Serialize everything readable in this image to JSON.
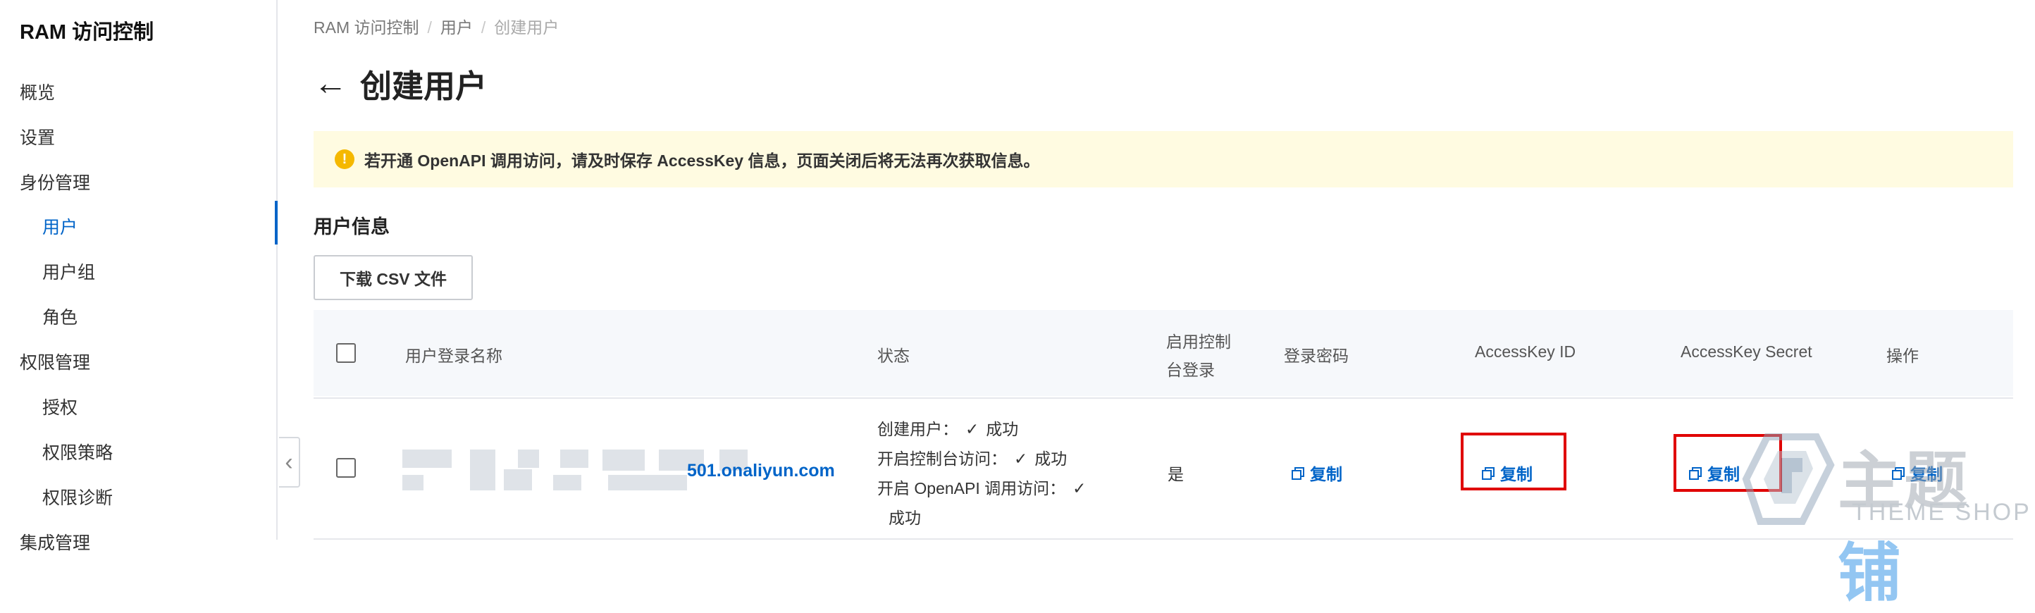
{
  "sidebar": {
    "title": "RAM 访问控制",
    "items": [
      {
        "label": "概览",
        "level": 1
      },
      {
        "label": "设置",
        "level": 1
      },
      {
        "label": "身份管理",
        "level": 1
      },
      {
        "label": "用户",
        "level": 2,
        "active": true
      },
      {
        "label": "用户组",
        "level": 2
      },
      {
        "label": "角色",
        "level": 2
      },
      {
        "label": "权限管理",
        "level": 1
      },
      {
        "label": "授权",
        "level": 2
      },
      {
        "label": "权限策略",
        "level": 2
      },
      {
        "label": "权限诊断",
        "level": 2
      },
      {
        "label": "集成管理",
        "level": 1
      }
    ]
  },
  "breadcrumb": [
    "RAM 访问控制",
    "用户",
    "创建用户"
  ],
  "page": {
    "title": "创建用户"
  },
  "alert": {
    "text": "若开通 OpenAPI 调用访问，请及时保存 AccessKey 信息，页面关闭后将无法再次获取信息。"
  },
  "section": {
    "title": "用户信息",
    "download_label": "下载 CSV 文件"
  },
  "table": {
    "columns": {
      "login_name": "用户登录名称",
      "status": "状态",
      "console_login_1": "启用控制",
      "console_login_2": "台登录",
      "password": "登录密码",
      "accesskey_id": "AccessKey ID",
      "accesskey_secret": "AccessKey Secret",
      "actions": "操作"
    },
    "rows": [
      {
        "login_name_suffix": "501.onaliyun.com",
        "status": {
          "create_user": "创建用户：",
          "create_user_result": "成功",
          "console_access": "开启控制台访问：",
          "console_access_result": "成功",
          "openapi_access": "开启 OpenAPI 调用访问：",
          "openapi_access_result": "成功"
        },
        "console_login": "是",
        "password_action": "复制",
        "accesskey_id_action": "复制",
        "accesskey_secret_action": "复制",
        "row_action": "复制"
      }
    ]
  },
  "watermark": {
    "main": "主题",
    "accent": "铺",
    "sub": "THEME SHOP"
  },
  "colors": {
    "accent": "#0064c8",
    "alert_bg": "#fffbe1",
    "warning": "#f5b800",
    "highlight": "#e00000"
  }
}
